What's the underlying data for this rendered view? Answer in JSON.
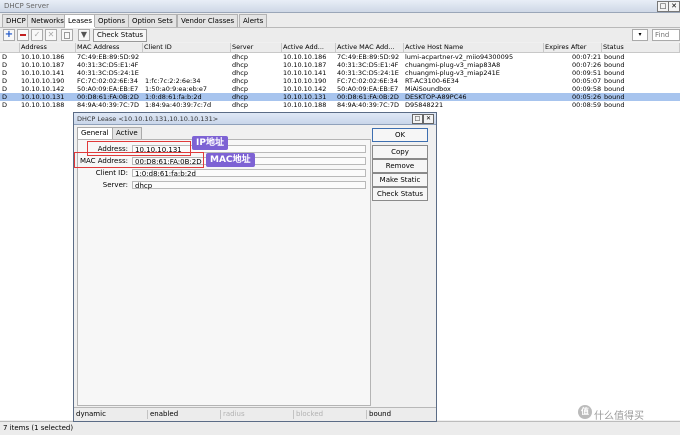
{
  "window": {
    "title": "DHCP Server"
  },
  "tabs": [
    "DHCP",
    "Networks",
    "Leases",
    "Options",
    "Option Sets",
    "Vendor Classes",
    "Alerts"
  ],
  "toolbar": {
    "check_status": "Check Status",
    "find_placeholder": "Find",
    "dropdown": "all"
  },
  "table": {
    "columns": [
      "",
      "Address",
      "MAC Address",
      "Client ID",
      "Server",
      "Active Add...",
      "Active MAC Add...",
      "Active Host Name",
      "Expires After",
      "Status"
    ],
    "rows": [
      [
        "D",
        "10.10.10.186",
        "7C:49:EB:89:5D:92",
        "",
        "dhcp",
        "10.10.10.186",
        "7C:49:EB:89:5D:92",
        "lumi-acpartner-v2_miio94300095",
        "00:07:21",
        "bound"
      ],
      [
        "D",
        "10.10.10.187",
        "40:31:3C:D5:E1:4F",
        "",
        "dhcp",
        "10.10.10.187",
        "40:31:3C:D5:E1:4F",
        "chuangmi-plug-v3_miap83A8",
        "00:07:26",
        "bound"
      ],
      [
        "D",
        "10.10.10.141",
        "40:31:3C:D5:24:1E",
        "",
        "dhcp",
        "10.10.10.141",
        "40:31:3C:D5:24:1E",
        "chuangmi-plug-v3_miap241E",
        "00:09:51",
        "bound"
      ],
      [
        "D",
        "10.10.10.190",
        "FC:7C:02:02:6E:34",
        "1:fc:7c:2:2:6e:34",
        "dhcp",
        "10.10.10.190",
        "FC:7C:02:02:6E:34",
        "RT-AC3100-6E34",
        "00:05:07",
        "bound"
      ],
      [
        "D",
        "10.10.10.142",
        "50:A0:09:EA:EB:E7",
        "1:50:a0:9:ea:eb:e7",
        "dhcp",
        "10.10.10.142",
        "50:A0:09:EA:EB:E7",
        "MiAiSoundbox",
        "00:09:58",
        "bound"
      ],
      [
        "D",
        "10.10.10.131",
        "00:D8:61:FA:0B:2D",
        "1:0:d8:61:fa:b:2d",
        "dhcp",
        "10.10.10.131",
        "00:D8:61:FA:0B:2D",
        "DESKTOP-A89PC46",
        "00:05:26",
        "bound"
      ],
      [
        "D",
        "10.10.10.188",
        "84:9A:40:39:7C:7D",
        "1:84:9a:40:39:7c:7d",
        "dhcp",
        "10.10.10.188",
        "84:9A:40:39:7C:7D",
        "D95848221",
        "00:08:59",
        "bound"
      ]
    ],
    "selected_row": 5
  },
  "statusbar": {
    "text": "7 items (1 selected)"
  },
  "dialog": {
    "title": "DHCP Lease <10.10.10.131,10.10.10.131>",
    "tabs": [
      "General",
      "Active"
    ],
    "fields": {
      "address_label": "Address:",
      "address_value": "10.10.10.131",
      "mac_label": "MAC Address:",
      "mac_value": "00:D8:61:FA:0B:2D",
      "clientid_label": "Client ID:",
      "clientid_value": "1:0:d8:61:fa:b:2d",
      "server_label": "Server:",
      "server_value": "dhcp"
    },
    "buttons": [
      "OK",
      "Copy",
      "Remove",
      "Make Static",
      "Check Status"
    ],
    "status": [
      "dynamic",
      "enabled",
      "radius",
      "blocked",
      "bound"
    ]
  },
  "annotations": {
    "ip": "IP地址",
    "mac": "MAC地址"
  },
  "watermark": {
    "text": "什么值得买",
    "logo": "值"
  }
}
